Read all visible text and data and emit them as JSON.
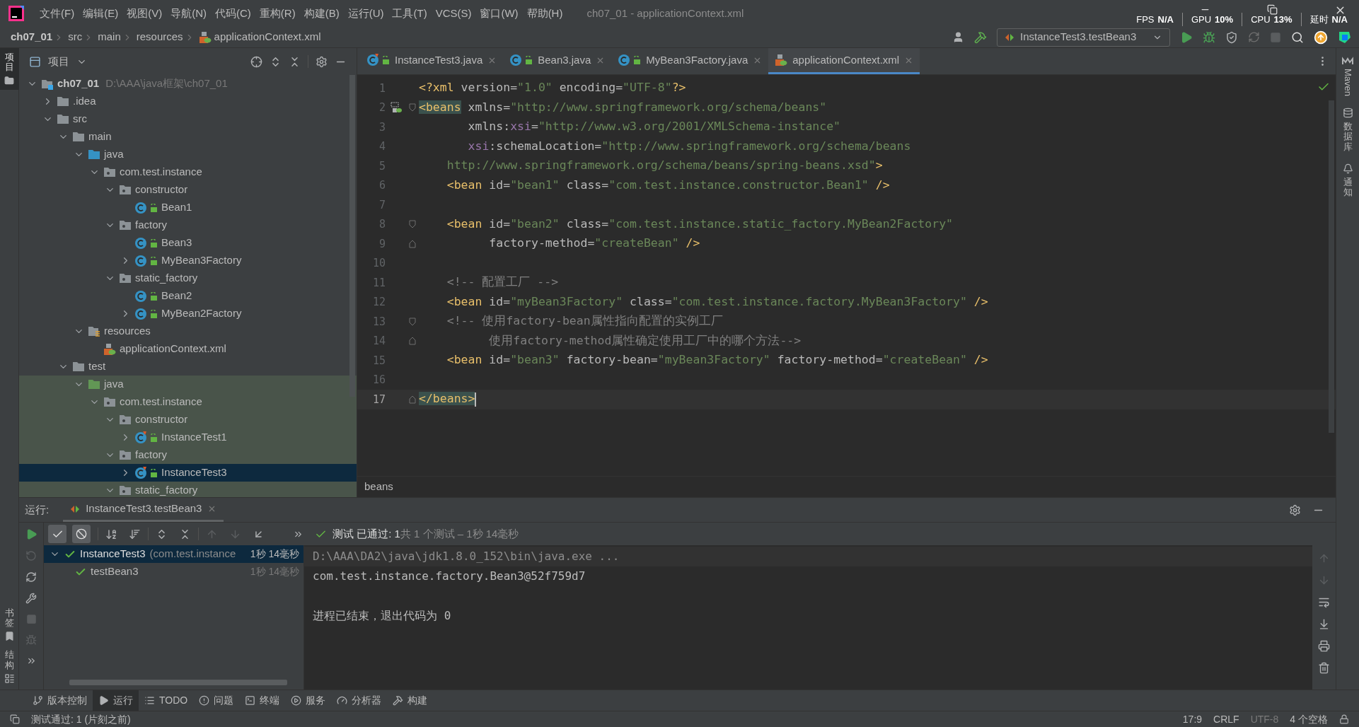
{
  "title_bar": {
    "menus": [
      "文件(F)",
      "编辑(E)",
      "视图(V)",
      "导航(N)",
      "代码(C)",
      "重构(R)",
      "构建(B)",
      "运行(U)",
      "工具(T)",
      "VCS(S)",
      "窗口(W)",
      "帮助(H)"
    ],
    "title": "ch07_01 - applicationContext.xml",
    "stats": [
      {
        "label": "FPS",
        "value": "N/A"
      },
      {
        "label": "GPU",
        "value": "10%"
      },
      {
        "label": "CPU",
        "value": "13%"
      },
      {
        "label": "延时",
        "value": "N/A"
      }
    ]
  },
  "nav_bar": {
    "breadcrumbs": [
      {
        "label": "ch07_01",
        "kind": "module"
      },
      {
        "label": "src",
        "kind": "folder"
      },
      {
        "label": "main",
        "kind": "folder"
      },
      {
        "label": "resources",
        "kind": "folder"
      },
      {
        "label": "applicationContext.xml",
        "kind": "xml"
      }
    ],
    "run_config": "InstanceTest3.testBean3"
  },
  "left_stripe": {
    "top": [
      {
        "label": "项目",
        "selected": true
      }
    ],
    "bottom": [
      {
        "label": "书签",
        "kind": "bookmarks"
      },
      {
        "label": "结构",
        "kind": "structure"
      }
    ]
  },
  "project": {
    "title": "项目",
    "tree": [
      {
        "label": "ch07_01",
        "path": "D:\\AAA\\java框架\\ch07_01",
        "kind": "module",
        "expanded": true,
        "selected": false,
        "children": [
          {
            "label": ".idea",
            "kind": "folder",
            "expanded": false,
            "selected": false
          },
          {
            "label": "src",
            "kind": "folder",
            "expanded": true,
            "selected": false,
            "children": [
              {
                "label": "main",
                "kind": "folder",
                "expanded": true,
                "selected": false,
                "children": [
                  {
                    "label": "java",
                    "kind": "source-root",
                    "expanded": true,
                    "selected": false,
                    "children": [
                      {
                        "label": "com.test.instance",
                        "kind": "package",
                        "expanded": true,
                        "selected": false,
                        "children": [
                          {
                            "label": "constructor",
                            "kind": "package",
                            "expanded": true,
                            "selected": false,
                            "children": [
                              {
                                "label": "Bean1",
                                "kind": "class",
                                "selected": false
                              }
                            ]
                          },
                          {
                            "label": "factory",
                            "kind": "package",
                            "expanded": true,
                            "selected": false,
                            "children": [
                              {
                                "label": "Bean3",
                                "kind": "class",
                                "selected": false
                              },
                              {
                                "label": "MyBean3Factory",
                                "kind": "class",
                                "expanded": false,
                                "selected": false
                              }
                            ]
                          },
                          {
                            "label": "static_factory",
                            "kind": "package",
                            "expanded": true,
                            "selected": false,
                            "children": [
                              {
                                "label": "Bean2",
                                "kind": "class",
                                "selected": false
                              },
                              {
                                "label": "MyBean2Factory",
                                "kind": "class",
                                "expanded": false,
                                "selected": false
                              }
                            ]
                          }
                        ]
                      }
                    ]
                  },
                  {
                    "label": "resources",
                    "kind": "resources",
                    "expanded": true,
                    "selected": false,
                    "children": [
                      {
                        "label": "applicationContext.xml",
                        "kind": "xml",
                        "selected": false
                      }
                    ]
                  }
                ]
              },
              {
                "label": "test",
                "kind": "folder",
                "expanded": true,
                "selected": false,
                "children": [
                  {
                    "label": "java",
                    "kind": "test-root",
                    "expanded": true,
                    "selected": false,
                    "children": [
                      {
                        "label": "com.test.instance",
                        "kind": "package",
                        "expanded": true,
                        "selected": false,
                        "children": [
                          {
                            "label": "constructor",
                            "kind": "package",
                            "expanded": true,
                            "selected": false,
                            "children": [
                              {
                                "label": "InstanceTest1",
                                "kind": "test-class",
                                "expanded": false,
                                "selected": false
                              }
                            ]
                          },
                          {
                            "label": "factory",
                            "kind": "package",
                            "expanded": true,
                            "selected": false,
                            "children": [
                              {
                                "label": "InstanceTest3",
                                "kind": "test-class",
                                "expanded": false,
                                "selected": true
                              }
                            ]
                          },
                          {
                            "label": "static_factory",
                            "kind": "package",
                            "expanded": true,
                            "selected": false
                          }
                        ]
                      }
                    ]
                  }
                ]
              }
            ]
          }
        ]
      }
    ]
  },
  "editor": {
    "tabs": [
      {
        "label": "InstanceTest3.java",
        "kind": "test-class",
        "selected": false
      },
      {
        "label": "Bean3.java",
        "kind": "class",
        "selected": false
      },
      {
        "label": "MyBean3Factory.java",
        "kind": "class",
        "selected": false
      },
      {
        "label": "applicationContext.xml",
        "kind": "xml",
        "selected": true
      }
    ],
    "lines": [
      {
        "number": "1",
        "current": false,
        "tokens": [
          {
            "kind": "tag",
            "text": "<?xml"
          },
          {
            "kind": "attr",
            "text": " version="
          },
          {
            "kind": "value",
            "text": "\"1.0\""
          },
          {
            "kind": "attr",
            "text": " encoding="
          },
          {
            "kind": "value",
            "text": "\"UTF-8\""
          },
          {
            "kind": "tag",
            "text": "?>"
          }
        ]
      },
      {
        "number": "2",
        "current": false,
        "bean_gutter": true,
        "fold_start": true,
        "tokens": [
          {
            "kind": "tag-match",
            "text": "<beans"
          },
          {
            "kind": "attr",
            "text": " xmlns="
          },
          {
            "kind": "value",
            "text": "\"http://www.springframework.org/schema/beans\""
          }
        ]
      },
      {
        "number": "3",
        "current": false,
        "tokens": [
          {
            "kind": "attr",
            "text": "       xmlns:"
          },
          {
            "kind": "ns",
            "text": "xsi"
          },
          {
            "kind": "attr",
            "text": "="
          },
          {
            "kind": "value",
            "text": "\"http://www.w3.org/2001/XMLSchema-instance\""
          }
        ]
      },
      {
        "number": "4",
        "current": false,
        "tokens": [
          {
            "kind": "ns",
            "text": "       xsi"
          },
          {
            "kind": "attr",
            "text": ":schemaLocation="
          },
          {
            "kind": "value",
            "text": "\"http://www.springframework.org/schema/beans"
          }
        ]
      },
      {
        "number": "5",
        "current": false,
        "tokens": [
          {
            "kind": "value",
            "text": "    http://www.springframework.org/schema/beans/spring-beans.xsd\""
          },
          {
            "kind": "tag",
            "text": ">"
          }
        ]
      },
      {
        "number": "6",
        "current": false,
        "tokens": [
          {
            "kind": "tag",
            "text": "    <bean"
          },
          {
            "kind": "attr",
            "text": " id="
          },
          {
            "kind": "value",
            "text": "\"bean1\""
          },
          {
            "kind": "attr",
            "text": " class="
          },
          {
            "kind": "value",
            "text": "\"com.test.instance.constructor.Bean1\""
          },
          {
            "kind": "tag",
            "text": " />"
          }
        ]
      },
      {
        "number": "7",
        "current": false
      },
      {
        "number": "8",
        "current": false,
        "fold_start": true,
        "tokens": [
          {
            "kind": "tag",
            "text": "    <bean"
          },
          {
            "kind": "attr",
            "text": " id="
          },
          {
            "kind": "value",
            "text": "\"bean2\""
          },
          {
            "kind": "attr",
            "text": " class="
          },
          {
            "kind": "value",
            "text": "\"com.test.instance.static_factory.MyBean2Factory\""
          }
        ]
      },
      {
        "number": "9",
        "current": false,
        "fold_end": true,
        "tokens": [
          {
            "kind": "attr",
            "text": "          factory-method="
          },
          {
            "kind": "value",
            "text": "\"createBean\""
          },
          {
            "kind": "tag",
            "text": " />"
          }
        ]
      },
      {
        "number": "10",
        "current": false
      },
      {
        "number": "11",
        "current": false,
        "tokens": [
          {
            "kind": "comment",
            "text": "    <!-- 配置工厂 -->"
          }
        ]
      },
      {
        "number": "12",
        "current": false,
        "tokens": [
          {
            "kind": "tag",
            "text": "    <bean"
          },
          {
            "kind": "attr",
            "text": " id="
          },
          {
            "kind": "value",
            "text": "\"myBean3Factory\""
          },
          {
            "kind": "attr",
            "text": " class="
          },
          {
            "kind": "value",
            "text": "\"com.test.instance.factory.MyBean3Factory\""
          },
          {
            "kind": "tag",
            "text": " />"
          }
        ]
      },
      {
        "number": "13",
        "current": false,
        "fold_start": true,
        "tokens": [
          {
            "kind": "comment",
            "text": "    <!-- 使用factory-bean属性指向配置的实例工厂"
          }
        ]
      },
      {
        "number": "14",
        "current": false,
        "fold_end": true,
        "tokens": [
          {
            "kind": "comment",
            "text": "          使用factory-method属性确定使用工厂中的哪个方法-->"
          }
        ]
      },
      {
        "number": "15",
        "current": false,
        "tokens": [
          {
            "kind": "tag",
            "text": "    <bean"
          },
          {
            "kind": "attr",
            "text": " id="
          },
          {
            "kind": "value",
            "text": "\"bean3\""
          },
          {
            "kind": "attr",
            "text": " factory-bean="
          },
          {
            "kind": "value",
            "text": "\"myBean3Factory\""
          },
          {
            "kind": "attr",
            "text": " factory-method="
          },
          {
            "kind": "value",
            "text": "\"createBean\""
          },
          {
            "kind": "tag",
            "text": " />"
          }
        ]
      },
      {
        "number": "16",
        "current": false
      },
      {
        "number": "17",
        "current": true,
        "fold_end": true,
        "tokens": [
          {
            "kind": "tag-match",
            "text": "</beans>"
          }
        ]
      }
    ],
    "breadcrumb": "beans"
  },
  "right_stripe": [
    {
      "label": "Maven",
      "kind": "maven"
    },
    {
      "label": "数据库",
      "kind": "database"
    },
    {
      "label": "通知",
      "kind": "notifications"
    }
  ],
  "run": {
    "label": "运行:",
    "tab": "InstanceTest3.testBean3",
    "filters": [
      {
        "kind": "passed",
        "on": true
      },
      {
        "kind": "ignored",
        "on": true
      }
    ],
    "status": "测试 已通过: 1",
    "summary": "共 1 个测试 – 1秒 14毫秒",
    "tests": [
      {
        "name": "InstanceTest3",
        "package": "(com.test.instance",
        "time": "1秒 14毫秒",
        "expanded": true,
        "selected": true,
        "children": [
          {
            "name": "testBean3",
            "time": "1秒 14毫秒",
            "selected": false
          }
        ]
      }
    ],
    "console": [
      {
        "kind": "command",
        "text": "D:\\AAA\\DA2\\java\\jdk1.8.0_152\\bin\\java.exe ..."
      },
      {
        "kind": "output",
        "text": "com.test.instance.factory.Bean3@52f759d7"
      },
      {
        "kind": "blank"
      },
      {
        "kind": "output",
        "text": "进程已结束，退出代码为 0"
      }
    ]
  },
  "bottom_tabs": [
    {
      "label": "版本控制",
      "kind": "vcs",
      "selected": false
    },
    {
      "label": "运行",
      "kind": "run",
      "selected": true
    },
    {
      "label": "TODO",
      "kind": "todo",
      "selected": false
    },
    {
      "label": "问题",
      "kind": "problems",
      "selected": false
    },
    {
      "label": "终端",
      "kind": "terminal",
      "selected": false
    },
    {
      "label": "服务",
      "kind": "services",
      "selected": false
    },
    {
      "label": "分析器",
      "kind": "profiler",
      "selected": false
    },
    {
      "label": "构建",
      "kind": "build",
      "selected": false
    }
  ],
  "status_bar": {
    "message": "测试通过: 1 (片刻之前)",
    "position": "17:9",
    "line_ending": "CRLF",
    "encoding": "UTF-8",
    "indent": "4 个空格"
  }
}
